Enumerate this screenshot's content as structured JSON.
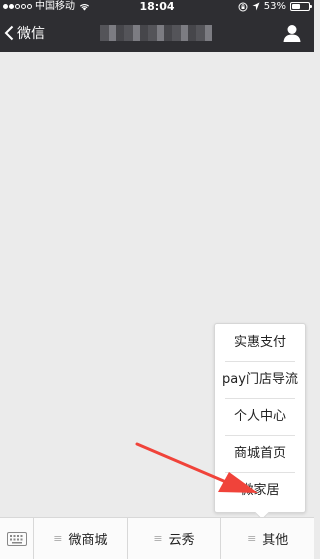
{
  "status_bar": {
    "carrier": "中国移动",
    "time": "18:04",
    "battery": "53%",
    "battery_level": 0.53
  },
  "nav": {
    "back_label": "微信"
  },
  "popup_menu": {
    "items": [
      "实惠支付",
      "pay门店导流",
      "个人中心",
      "商城首页",
      "微家居"
    ]
  },
  "bottom_menu": {
    "items": [
      {
        "label": "微商城"
      },
      {
        "label": "云秀"
      },
      {
        "label": "其他"
      }
    ]
  },
  "colors": {
    "header_bg": "#2e2e32",
    "page_bg": "#ebebeb",
    "arrow": "#f0433a"
  }
}
